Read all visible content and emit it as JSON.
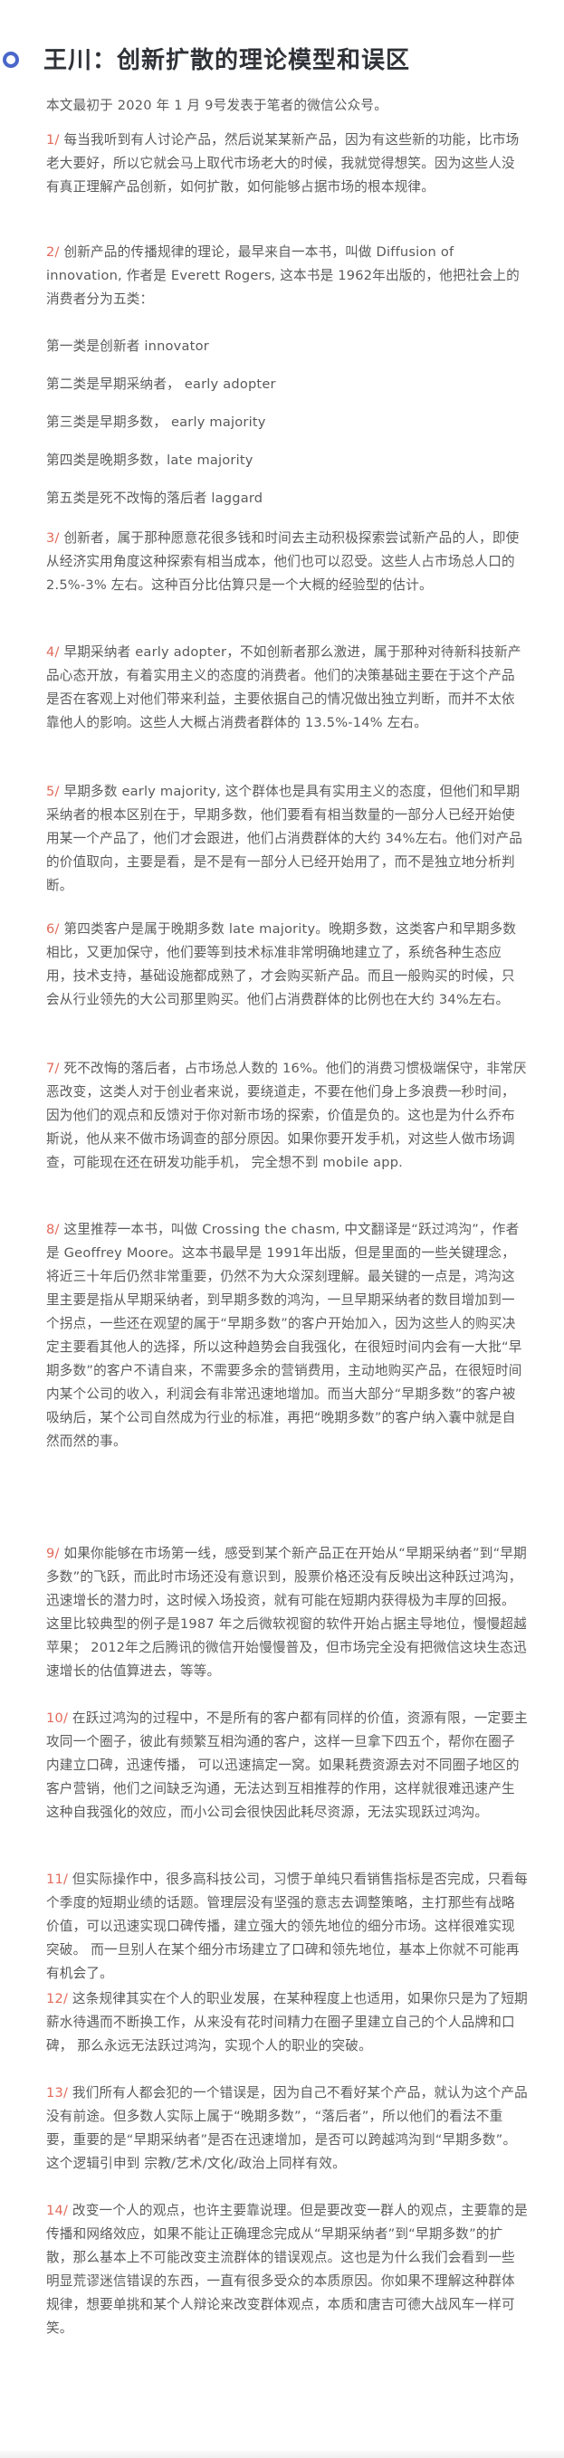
{
  "title": "王川：创新扩散的理论模型和误区",
  "intro": "本文最初于 2020 年 1 月 9号发表于笔者的微信公众号。",
  "paragraphs": [
    {
      "num": "1/",
      "text": " 每当我听到有人讨论产品，然后说某某新产品，因为有这些新的功能，比市场老大要好，所以它就会马上取代市场老大的时候，我就觉得想笑。因为这些人没有真正理解产品创新，如何扩散，如何能够占据市场的根本规律。"
    },
    {
      "num": "2/",
      "text": " 创新产品的传播规律的理论，最早来自一本书，叫做 Diffusion of innovation, 作者是 Everett Rogers, 这本书是 1962年出版的，他把社会上的消费者分为五类："
    },
    {
      "num": "",
      "text": "第一类是创新者 innovator"
    },
    {
      "num": "",
      "text": "第二类是早期采纳者， early adopter"
    },
    {
      "num": "",
      "text": "第三类是早期多数， early majority"
    },
    {
      "num": "",
      "text": "第四类是晚期多数，late majority"
    },
    {
      "num": "",
      "text": "第五类是死不改悔的落后者 laggard"
    },
    {
      "num": "3/",
      "text": " 创新者，属于那种愿意花很多钱和时间去主动积极探索尝试新产品的人，即使从经济实用角度这种探索有相当成本，他们也可以忍受。这些人占市场总人口的 2.5%-3% 左右。这种百分比估算只是一个大概的经验型的估计。"
    },
    {
      "num": "4/",
      "text": " 早期采纳者 early adopter，不如创新者那么激进，属于那种对待新科技新产品心态开放，有着实用主义的态度的消费者。他们的决策基础主要在于这个产品是否在客观上对他们带来利益，主要依据自己的情况做出独立判断，而并不太依靠他人的影响。这些人大概占消费者群体的 13.5%-14% 左右。"
    },
    {
      "num": "5/",
      "text": " 早期多数 early majority, 这个群体也是具有实用主义的态度，但他们和早期采纳者的根本区别在于，早期多数，他们要看有相当数量的一部分人已经开始使用某一个产品了，他们才会跟进，他们占消费群体的大约 34%左右。他们对产品的价值取向，主要是看，是不是有一部分人已经开始用了，而不是独立地分析判断。"
    },
    {
      "num": "6/",
      "text": " 第四类客户是属于晚期多数 late majority。晚期多数，这类客户和早期多数相比，又更加保守，他们要等到技术标准非常明确地建立了，系统各种生态应用，技术支持，基础设施都成熟了，才会购买新产品。而且一般购买的时候，只会从行业领先的大公司那里购买。他们占消费群体的比例也在大约 34%左右。"
    },
    {
      "num": "7/",
      "text": " 死不改悔的落后者，占市场总人数的 16%。他们的消费习惯极端保守，非常厌恶改变，这类人对于创业者来说，要绕道走，不要在他们身上多浪费一秒时间，因为他们的观点和反馈对于你对新市场的探索，价值是负的。这也是为什么乔布斯说，他从来不做市场调查的部分原因。如果你要开发手机，对这些人做市场调查，可能现在还在研发功能手机， 完全想不到 mobile app."
    },
    {
      "num": "8/",
      "text": " 这里推荐一本书，叫做 Crossing the chasm, 中文翻译是“跃过鸿沟”，作者是 Geoffrey Moore。这本书最早是 1991年出版，但是里面的一些关键理念，将近三十年后仍然非常重要，仍然不为大众深刻理解。最关键的一点是，鸿沟这里主要是指从早期采纳者，到早期多数的鸿沟，一旦早期采纳者的数目增加到一个拐点，一些还在观望的属于“早期多数”的客户开始加入，因为这些人的购买决定主要看其他人的选择，所以这种趋势会自我强化，在很短时间内会有一大批“早期多数”的客户不请自来，不需要多余的营销费用，主动地购买产品，在很短时间内某个公司的收入，利润会有非常迅速地增加。而当大部分“早期多数”的客户被吸纳后，某个公司自然成为行业的标准，再把“晚期多数”的客户纳入囊中就是自然而然的事。"
    },
    {
      "num": "9/",
      "text": " 如果你能够在市场第一线，感受到某个新产品正在开始从“早期采纳者”到“早期多数”的飞跃，而此时市场还没有意识到，股票价格还没有反映出这种跃过鸿沟，迅速增长的潜力时，这时候入场投资，就有可能在短期内获得极为丰厚的回报。这里比较典型的例子是1987 年之后微软视窗的软件开始占据主导地位，慢慢超越苹果； 2012年之后腾讯的微信开始慢慢普及，但市场完全没有把微信这块生态迅速增长的估值算进去，等等。"
    },
    {
      "num": "10/",
      "text": " 在跃过鸿沟的过程中，不是所有的客户都有同样的价值，资源有限，一定要主攻同一个圈子，彼此有频繁互相沟通的客户，这样一旦拿下四五个，帮你在圈子内建立口碑，迅速传播， 可以迅速搞定一窝。如果耗费资源去对不同圈子地区的客户营销，他们之间缺乏沟通，无法达到互相推荐的作用，这样就很难迅速产生这种自我强化的效应，而小公司会很快因此耗尽资源，无法实现跃过鸿沟。"
    },
    {
      "num": "11/",
      "text": " 但实际操作中，很多高科技公司，习惯于单纯只看销售指标是否完成，只看每个季度的短期业绩的话题。管理层没有坚强的意志去调整策略，主打那些有战略价值，可以迅速实现口碑传播，建立强大的领先地位的细分市场。这样很难实现突破。 而一旦别人在某个细分市场建立了口碑和领先地位，基本上你就不可能再有机会了。"
    },
    {
      "num": "12/",
      "text": " 这条规律其实在个人的职业发展，在某种程度上也适用，如果你只是为了短期薪水待遇而不断换工作，从来没有花时间精力在圈子里建立自己的个人品牌和口碑， 那么永远无法跃过鸿沟，实现个人的职业的突破。"
    },
    {
      "num": "13/",
      "text": " 我们所有人都会犯的一个错误是，因为自己不看好某个产品，就认为这个产品没有前途。但多数人实际上属于“晚期多数”，“落后者”，所以他们的看法不重要，重要的是“早期采纳者”是否在迅速增加，是否可以跨越鸿沟到“早期多数”。这个逻辑引申到 宗教/艺术/文化/政治上同样有效。"
    },
    {
      "num": "14/",
      "text": " 改变一个人的观点，也许主要靠说理。但是要改变一群人的观点，主要靠的是传播和网络效应，如果不能让正确理念完成从“早期采纳者”到“早期多数”的扩散，那么基本上不可能改变主流群体的错误观点。这也是为什么我们会看到一些明显荒谬迷信错误的东西，一直有很多受众的本质原因。你如果不理解这种群体规律，想要单挑和某个人辩论来改变群体观点，本质和唐吉可德大战风车一样可笑。"
    }
  ]
}
